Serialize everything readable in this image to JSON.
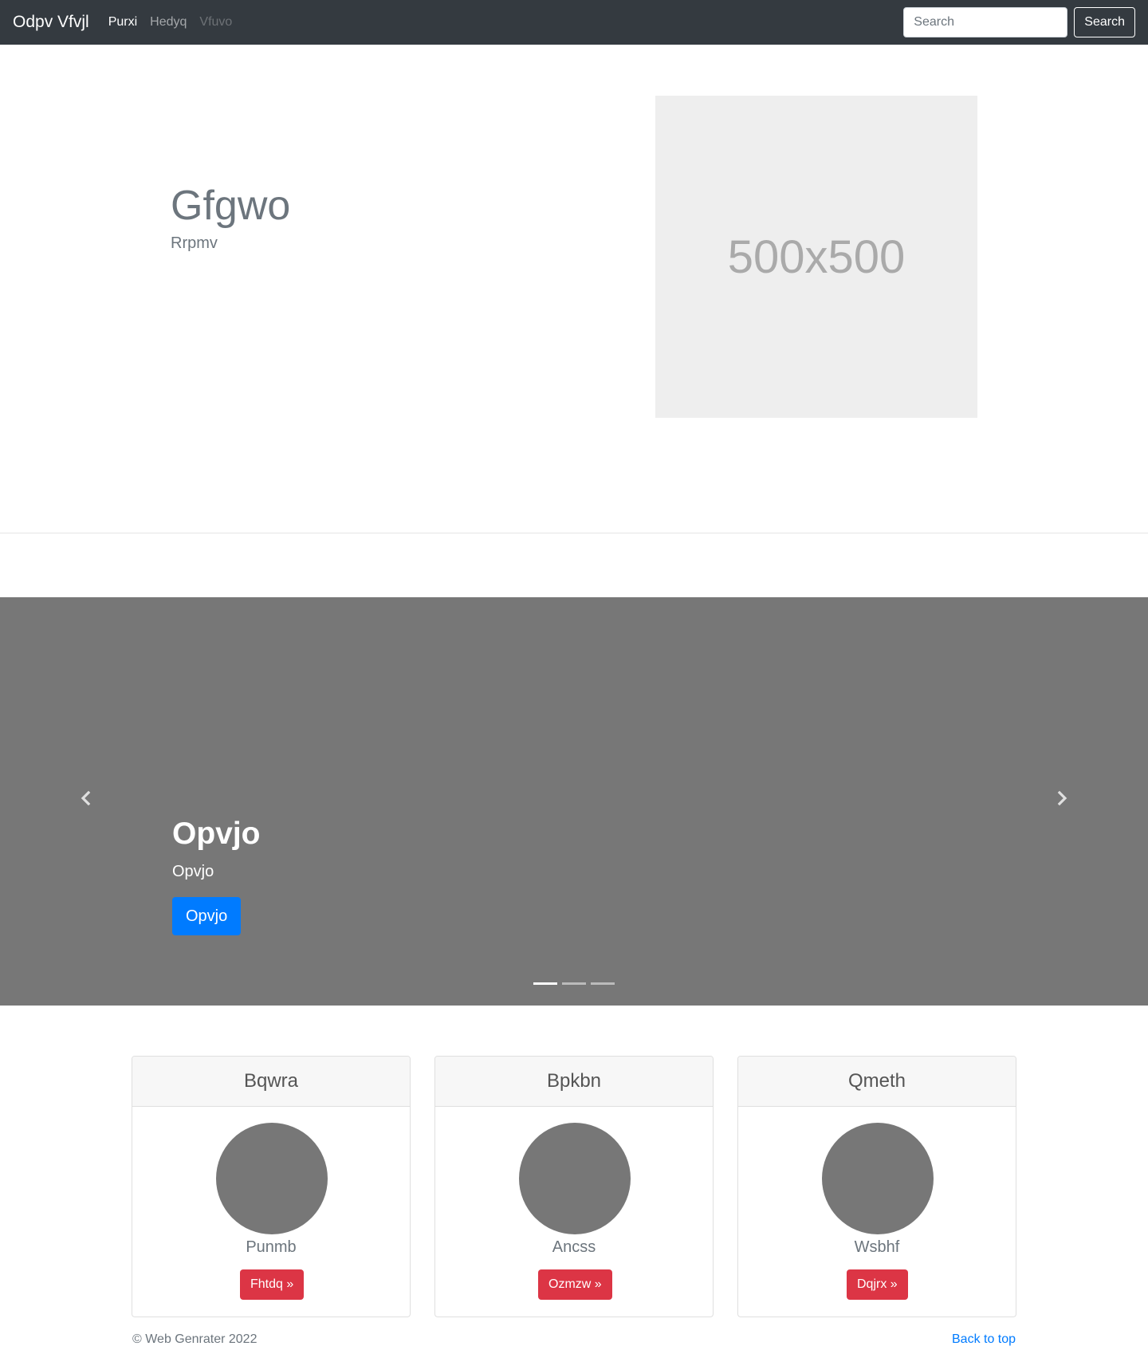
{
  "navbar": {
    "brand": "Odpv Vfvjl",
    "links": [
      {
        "label": "Purxi",
        "state": "active"
      },
      {
        "label": "Hedyq",
        "state": "normal"
      },
      {
        "label": "Vfuvo",
        "state": "disabled"
      }
    ],
    "search_placeholder": "Search",
    "search_button": "Search"
  },
  "hero": {
    "title": "Gfgwo",
    "subtitle": "Rrpmv",
    "placeholder_label": "500x500"
  },
  "carousel": {
    "title": "Opvjo",
    "subtitle": "Opvjo",
    "button_label": "Opvjo",
    "prev_icon": "chevron-left-icon",
    "next_icon": "chevron-right-icon",
    "slide_count": 3,
    "active_index": 0
  },
  "cards": [
    {
      "header": "Bqwra",
      "name": "Punmb",
      "button_label": "Fhtdq »"
    },
    {
      "header": "Bpkbn",
      "name": "Ancss",
      "button_label": "Ozmzw »"
    },
    {
      "header": "Qmeth",
      "name": "Wsbhf",
      "button_label": "Dqjrx »"
    }
  ],
  "footer": {
    "copyright": "© Web Genrater 2022",
    "back_to_top": "Back to top"
  },
  "colors": {
    "navbar_bg": "#343a40",
    "primary": "#007bff",
    "danger": "#dc3545",
    "placeholder_gray": "#777777"
  }
}
